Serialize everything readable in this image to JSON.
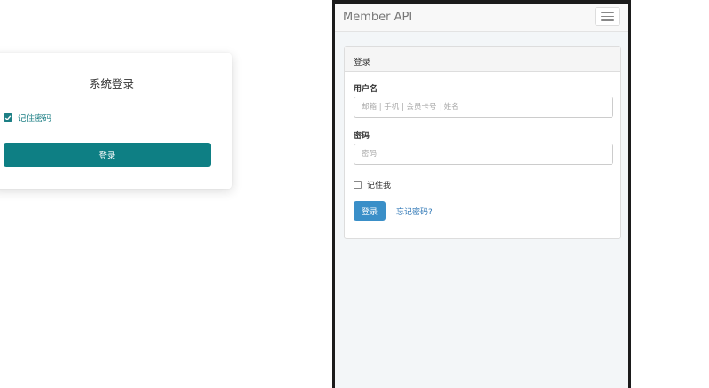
{
  "system_login": {
    "title": "系统登录",
    "remember_label": "记住密码",
    "remember_checked": true,
    "login_button": "登录"
  },
  "member_app": {
    "brand": "Member API",
    "panel_title": "登录",
    "username": {
      "label": "用户名",
      "placeholder": "邮箱 | 手机 | 会员卡号 | 姓名",
      "value": ""
    },
    "password": {
      "label": "密码",
      "placeholder": "密码",
      "value": ""
    },
    "remember_label": "记住我",
    "remember_checked": false,
    "login_button": "登录",
    "forgot_link": "忘记密码?"
  },
  "icons": {
    "remember_check": "check-icon",
    "menu_toggle": "hamburger-menu-icon"
  },
  "colors": {
    "system_accent": "#0e7f84",
    "member_primary": "#3a8fc8",
    "link": "#337ab7"
  }
}
